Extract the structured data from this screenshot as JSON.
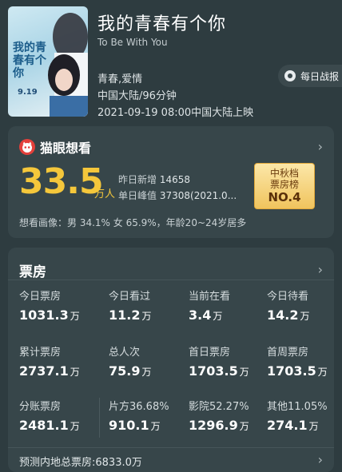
{
  "movie": {
    "title": "我的青春有个你",
    "subtitle": "To Be With You",
    "genre": "青春,爱情",
    "region_duration": "中国大陆/96分钟",
    "release": "2021-09-19 08:00中国大陆上映",
    "poster": {
      "title_text": "我的青春有个你",
      "date_text": "9.19"
    }
  },
  "daily_report": {
    "label": "每日战报",
    "icon": "record-icon"
  },
  "maoyan": {
    "label": "猫眼想看",
    "icon": "maoyan-cat-icon",
    "want_count": "33.5",
    "want_unit": "万人",
    "yesterday_label": "昨日新增",
    "yesterday_value": "14658",
    "peak_label": "单日峰值",
    "peak_value": "37308(2021.0...",
    "rank": {
      "line1": "中秋档",
      "line2": "票房榜",
      "line3": "NO.4"
    },
    "portrait": "想看画像：男 34.1%  女 65.9%，年龄20~24岁居多"
  },
  "boxoffice": {
    "title": "票房",
    "rows": [
      [
        {
          "label": "今日票房",
          "value": "1031.3",
          "unit": "万"
        },
        {
          "label": "今日看过",
          "value": "11.2",
          "unit": "万"
        },
        {
          "label": "当前在看",
          "value": "3.4",
          "unit": "万"
        },
        {
          "label": "今日待看",
          "value": "14.2",
          "unit": "万"
        }
      ],
      [
        {
          "label": "累计票房",
          "value": "2737.1",
          "unit": "万"
        },
        {
          "label": "总人次",
          "value": "75.9",
          "unit": "万"
        },
        {
          "label": "首日票房",
          "value": "1703.5",
          "unit": "万"
        },
        {
          "label": "首周票房",
          "value": "1703.5",
          "unit": "万"
        }
      ],
      [
        {
          "label": "分账票房",
          "value": "2481.1",
          "unit": "万"
        },
        {
          "label": "片方36.68%",
          "value": "910.1",
          "unit": "万"
        },
        {
          "label": "影院52.27%",
          "value": "1296.9",
          "unit": "万"
        },
        {
          "label": "其他11.05%",
          "value": "274.1",
          "unit": "万"
        }
      ]
    ],
    "forecast": "预测内地总票房:6833.0万"
  },
  "icons": {
    "chevron": "›"
  },
  "colors": {
    "accent_gold": "#f5c73b",
    "maoyan_red": "#e4403b",
    "background": "#2e3c40",
    "card": "#37464a"
  }
}
